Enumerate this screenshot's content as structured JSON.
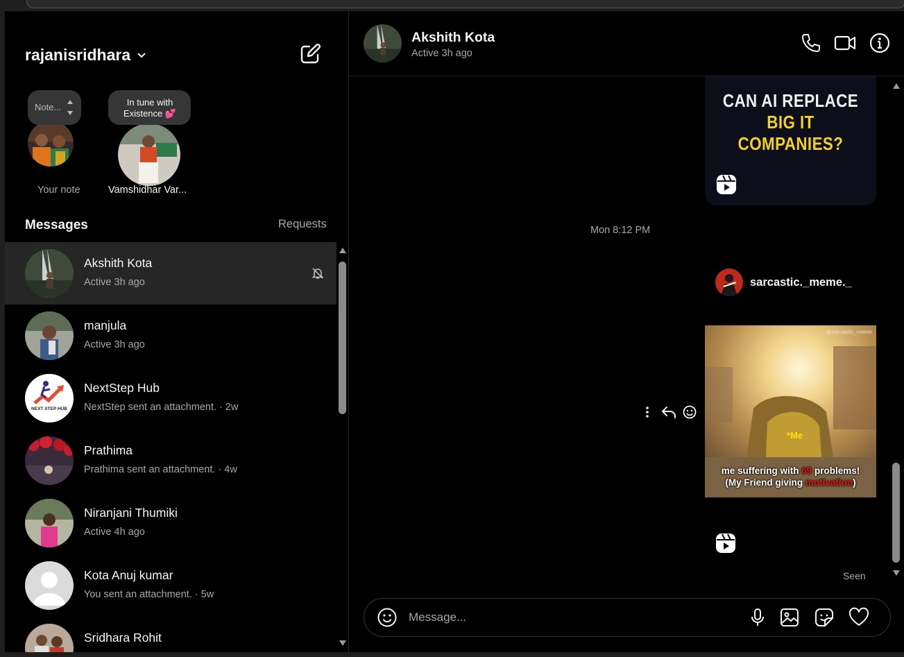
{
  "account": {
    "username": "rajanisridhara"
  },
  "notes": [
    {
      "bubble": "Note...",
      "name": "Your note"
    },
    {
      "bubble": "In tune with Existence 💕",
      "name": "Vamshidhar Var..."
    }
  ],
  "sidebar": {
    "messages_label": "Messages",
    "requests_label": "Requests"
  },
  "conversations": [
    {
      "name": "Akshith Kota",
      "status": "Active 3h ago",
      "muted": true,
      "selected": true
    },
    {
      "name": "manjula",
      "status": "Active 3h ago"
    },
    {
      "name": "NextStep Hub",
      "status": "NextStep sent an attachment. · 2w",
      "avatar_text": "NEXT STEP HUB"
    },
    {
      "name": "Prathima",
      "status": "Prathima sent an attachment. · 4w"
    },
    {
      "name": "Niranjani Thumiki",
      "status": "Active 4h ago"
    },
    {
      "name": "Kota Anuj kumar",
      "status": "You sent an attachment. · 5w"
    },
    {
      "name": "Sridhara Rohit",
      "status": ""
    }
  ],
  "chat": {
    "name": "Akshith Kota",
    "status": "Active 3h ago",
    "reel1": {
      "line1": "CAN AI REPLACE",
      "line2": "BIG IT COMPANIES?"
    },
    "timestamp": "Mon 8:12 PM",
    "shared_from": "sarcastic._meme._",
    "reel2": {
      "watermark": "@sarcastic_meme",
      "overlay": "*Me",
      "caption_a": "me suffering with ",
      "caption_num": "69",
      "caption_b": " problems!",
      "caption_c": "(My Friend giving ",
      "caption_red": "motivation",
      "caption_d": ")"
    },
    "seen": "Seen"
  },
  "composer": {
    "placeholder": "Message..."
  },
  "colors": {
    "bg": "#000000",
    "selected_row": "#262626",
    "muted_text": "#a8a8a8",
    "accent_yellow": "#f4d021"
  }
}
